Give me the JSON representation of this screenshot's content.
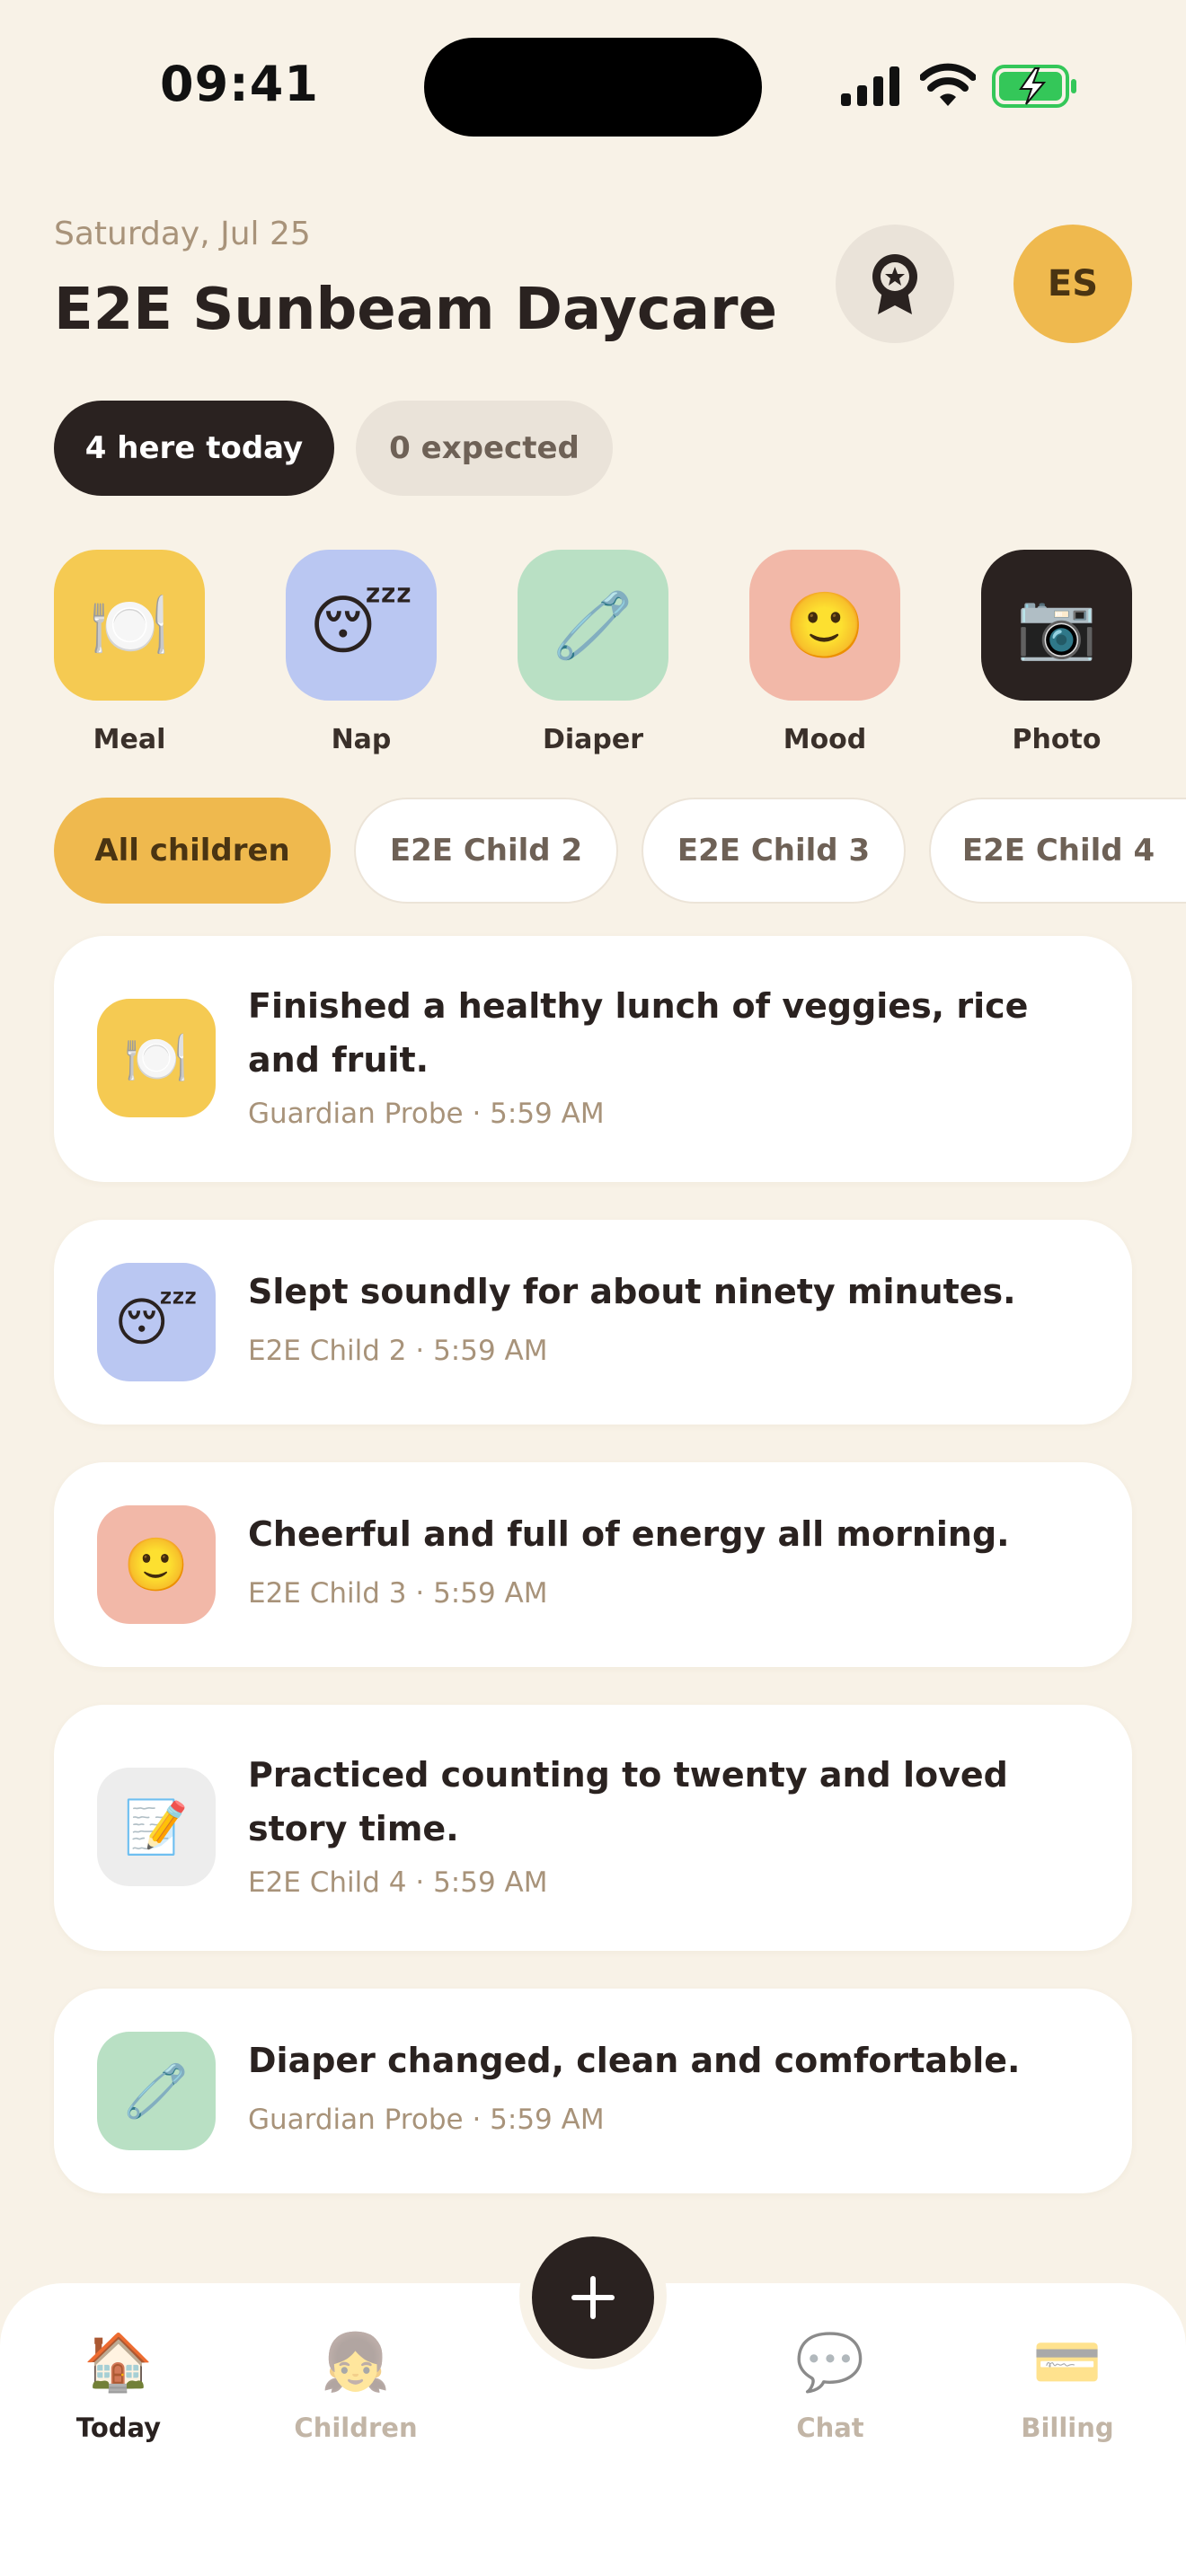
{
  "status_bar": {
    "time": "09:41"
  },
  "header": {
    "date": "Saturday, Jul 25",
    "title": "E2E Sunbeam Daycare",
    "avatar_initials": "ES",
    "award_icon": "award-icon"
  },
  "attendance": {
    "here": "4 here today",
    "expected": "0 expected"
  },
  "quick_actions": [
    {
      "label": "Meal",
      "icon": "🍽️",
      "color": "#F5CA52"
    },
    {
      "label": "Nap",
      "icon": "😴",
      "color": "#BAC7F2"
    },
    {
      "label": "Diaper",
      "icon": "🧷",
      "color": "#B9E0C4"
    },
    {
      "label": "Mood",
      "icon": "🙂",
      "color": "#F2B8A8"
    },
    {
      "label": "Photo",
      "icon": "📷",
      "color": "#2A2220"
    }
  ],
  "filters": [
    "All children",
    "E2E Child 2",
    "E2E Child 3",
    "E2E Child 4"
  ],
  "feed": [
    {
      "icon": "🍽️",
      "text": "Finished a healthy lunch of veggies, rice and fruit.",
      "meta": "Guardian Probe · 5:59 AM"
    },
    {
      "icon": "😴",
      "text": "Slept soundly for about ninety minutes.",
      "meta": "E2E Child 2 · 5:59 AM"
    },
    {
      "icon": "🙂",
      "text": "Cheerful and full of energy all morning.",
      "meta": "E2E Child 3 · 5:59 AM"
    },
    {
      "icon": "📝",
      "text": "Practiced counting to twenty and loved story time.",
      "meta": "E2E Child 4 · 5:59 AM"
    },
    {
      "icon": "🧷",
      "text": "Diaper changed, clean and comfortable.",
      "meta": "Guardian Probe · 5:59 AM"
    }
  ],
  "nav": {
    "tabs": [
      {
        "label": "Today",
        "icon": "🏠"
      },
      {
        "label": "Children",
        "icon": "👧"
      },
      {
        "label": "Chat",
        "icon": "💬"
      },
      {
        "label": "Billing",
        "icon": "💳"
      }
    ],
    "fab": "+"
  },
  "colors": {
    "background": "#F8F2E7",
    "accent": "#EFB94E",
    "dark": "#2A2220",
    "muted": "#A8937A"
  }
}
